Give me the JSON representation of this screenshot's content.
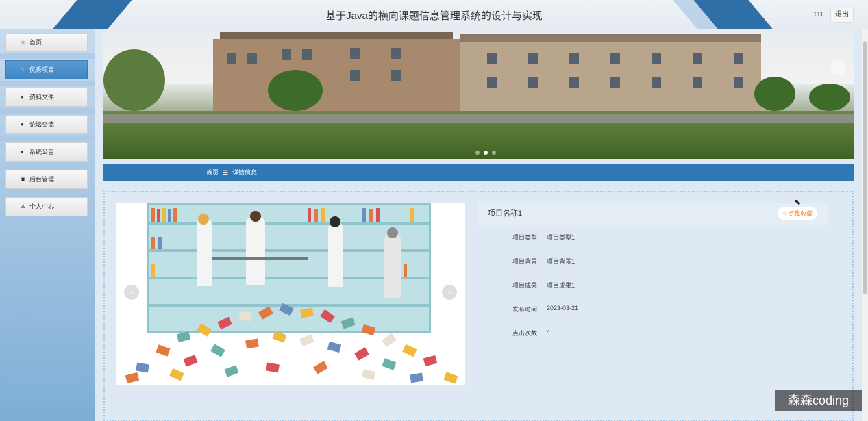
{
  "header": {
    "title": "基于Java的横向课题信息管理系统的设计与实现",
    "username": "111",
    "logout_label": "退出"
  },
  "sidebar": {
    "items": [
      {
        "label": "首页",
        "icon": "star-icon",
        "active": false
      },
      {
        "label": "优秀项目",
        "icon": "bag-icon",
        "active": true
      },
      {
        "label": "资料文件",
        "icon": "info-circle-icon",
        "active": false
      },
      {
        "label": "论坛交流",
        "icon": "question-circle-icon",
        "active": false
      },
      {
        "label": "系统公告",
        "icon": "info-circle-icon",
        "active": false
      },
      {
        "label": "后台管理",
        "icon": "calendar-icon",
        "active": false
      },
      {
        "label": "个人中心",
        "icon": "user-icon",
        "active": false
      }
    ]
  },
  "banner": {
    "slide_count": 3,
    "active_slide": 2
  },
  "breadcrumb": {
    "home": "首页",
    "separator": "☰",
    "current": "详情信息"
  },
  "detail": {
    "name": "项目名称1",
    "favorite_label": "☆点我收藏",
    "fields": [
      {
        "key": "项目类型",
        "value": "项目类型1"
      },
      {
        "key": "项目背景",
        "value": "项目背景1"
      },
      {
        "key": "项目成果",
        "value": "项目成果1"
      },
      {
        "key": "发布时间",
        "value": "2023-03-21"
      },
      {
        "key": "点击次数",
        "value": "4"
      }
    ]
  },
  "watermark": "森森coding",
  "colors": {
    "primary": "#2f78b5",
    "sidebar_active": "#4a8fc9",
    "favorite": "#e9893b"
  }
}
